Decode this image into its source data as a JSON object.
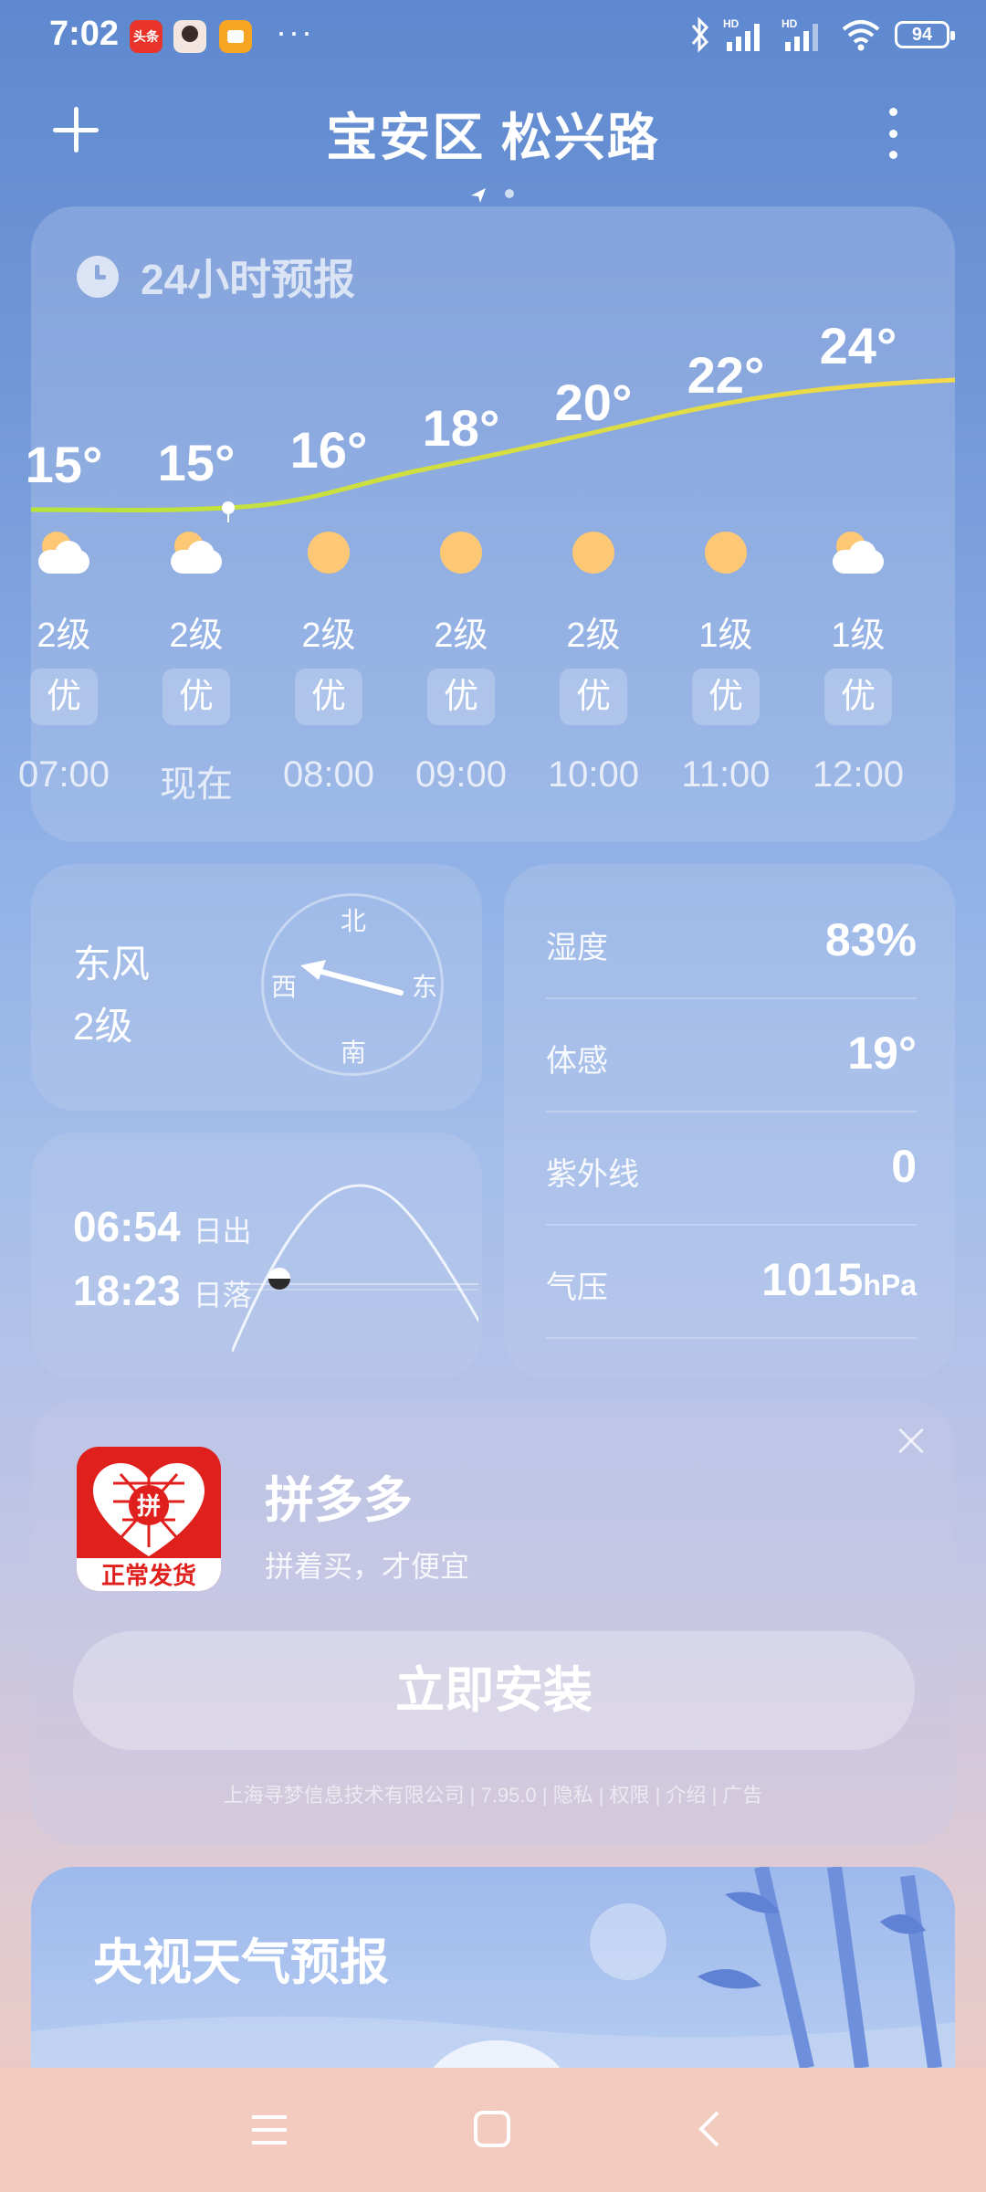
{
  "status_bar": {
    "time": "7:02",
    "apps": [
      {
        "icon": "toutiao-icon",
        "label": "头条",
        "color": "#e8342b"
      },
      {
        "icon": "avatar-app-icon",
        "color": "#f3e6e0"
      },
      {
        "icon": "message-app-icon",
        "color": "#f6a623"
      }
    ],
    "more": "···",
    "battery": "94"
  },
  "header": {
    "title": "宝安区 松兴路",
    "add_icon": "plus-icon",
    "menu_icon": "more-vertical-icon"
  },
  "forecast": {
    "title": "24小时预报",
    "hours": [
      {
        "time": "07:00",
        "temp": "15°",
        "weather": "partly-cloudy",
        "wind": "2级",
        "aqi": "优"
      },
      {
        "time": "现在",
        "temp": "15°",
        "weather": "partly-cloudy",
        "wind": "2级",
        "aqi": "优"
      },
      {
        "time": "08:00",
        "temp": "16°",
        "weather": "sunny",
        "wind": "2级",
        "aqi": "优"
      },
      {
        "time": "09:00",
        "temp": "18°",
        "weather": "sunny",
        "wind": "2级",
        "aqi": "优"
      },
      {
        "time": "10:00",
        "temp": "20°",
        "weather": "sunny",
        "wind": "2级",
        "aqi": "优"
      },
      {
        "time": "11:00",
        "temp": "22°",
        "weather": "sunny",
        "wind": "1级",
        "aqi": "优"
      },
      {
        "time": "12:00",
        "temp": "24°",
        "weather": "partly-cloudy",
        "wind": "1级",
        "aqi": "优"
      }
    ]
  },
  "wind": {
    "direction": "东风",
    "level": "2级",
    "compass": {
      "n": "北",
      "s": "南",
      "w": "西",
      "e": "东"
    }
  },
  "sun": {
    "sunrise_time": "06:54",
    "sunrise_label": "日出",
    "sunset_time": "18:23",
    "sunset_label": "日落"
  },
  "details": {
    "humidity_label": "湿度",
    "humidity": "83%",
    "feels_label": "体感",
    "feels": "19°",
    "uv_label": "紫外线",
    "uv": "0",
    "pressure_label": "气压",
    "pressure": "1015",
    "pressure_unit": "hPa"
  },
  "ad": {
    "app_name": "拼多多",
    "slogan": "拼着买，才便宜",
    "logo_char": "拼",
    "logo_banner": "正常发货",
    "install": "立即安装",
    "footer": "上海寻梦信息技术有限公司 | 7.95.0 | 隐私 | 权限 | 介绍 | 广告"
  },
  "cctv": {
    "title": "央视天气预报"
  },
  "colors": {
    "temp_line_start": "#b6e33a",
    "temp_line_end": "#f4d94a",
    "sun": "#fcc875",
    "pdd_red": "#e0201d"
  }
}
